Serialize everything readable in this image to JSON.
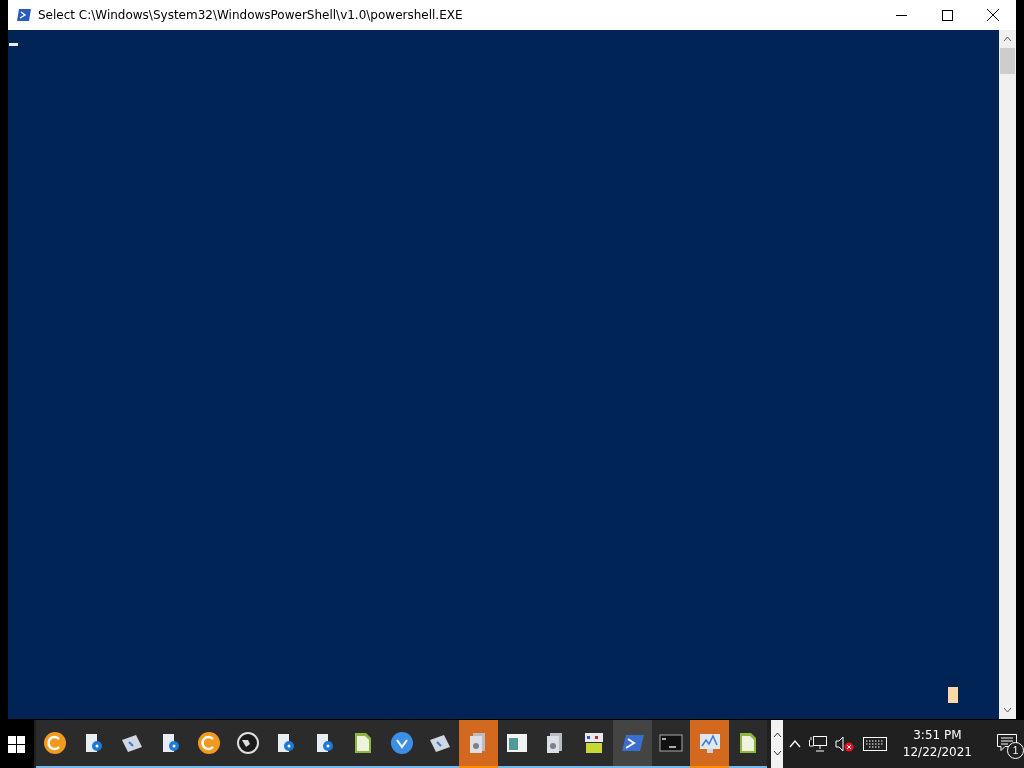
{
  "window": {
    "title": "Select C:\\Windows\\System32\\WindowsPowerShell\\v1.0\\powershell.EXE"
  },
  "taskbar": {
    "apps": [
      {
        "selected": false,
        "flashing": false
      },
      {
        "selected": false,
        "flashing": false
      },
      {
        "selected": false,
        "flashing": false
      },
      {
        "selected": false,
        "flashing": false
      },
      {
        "selected": false,
        "flashing": false
      },
      {
        "selected": false,
        "flashing": false
      },
      {
        "selected": false,
        "flashing": false
      },
      {
        "selected": false,
        "flashing": false
      },
      {
        "selected": false,
        "flashing": false
      },
      {
        "selected": false,
        "flashing": false
      },
      {
        "selected": false,
        "flashing": false
      },
      {
        "selected": false,
        "flashing": true
      },
      {
        "selected": false,
        "flashing": false
      },
      {
        "selected": false,
        "flashing": false
      },
      {
        "selected": false,
        "flashing": false
      },
      {
        "selected": true,
        "flashing": false
      },
      {
        "selected": false,
        "flashing": false
      },
      {
        "selected": false,
        "flashing": true
      },
      {
        "selected": false,
        "flashing": false
      }
    ],
    "clock": {
      "time": "3:51 PM",
      "date": "12/22/2021"
    },
    "notifications": {
      "count": "1"
    }
  }
}
